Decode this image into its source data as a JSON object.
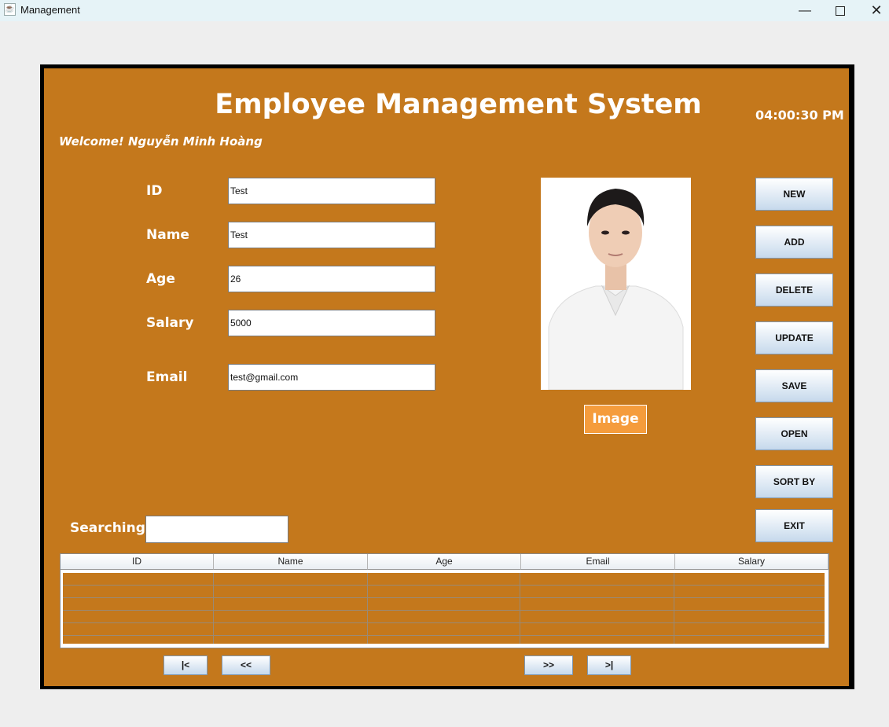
{
  "window": {
    "title": "Management",
    "icon": "java-coffee-icon"
  },
  "header": {
    "title": "Employee Management System",
    "clock": "04:00:30 PM",
    "welcome": "Welcome! Nguyễn Minh Hoàng"
  },
  "form": {
    "fields": [
      {
        "label": "ID",
        "value": "Test"
      },
      {
        "label": "Name",
        "value": "Test"
      },
      {
        "label": "Age",
        "value": "26"
      },
      {
        "label": "Salary",
        "value": "5000"
      },
      {
        "label": "Email",
        "value": "test@gmail.com"
      }
    ]
  },
  "photo": {
    "image_button": "Image"
  },
  "actions": [
    "NEW",
    "ADD",
    "DELETE",
    "UPDATE",
    "SAVE",
    "OPEN",
    "SORT BY",
    "EXIT"
  ],
  "search": {
    "label": "Searching",
    "value": ""
  },
  "table": {
    "columns": [
      "ID",
      "Name",
      "Age",
      "Email",
      "Salary"
    ]
  },
  "pager": {
    "first": "|<",
    "prev": "<<",
    "next": ">>",
    "last": ">|"
  },
  "colors": {
    "panel": "#c4781c",
    "image_button": "#f59c3c",
    "frame": "#000000"
  }
}
